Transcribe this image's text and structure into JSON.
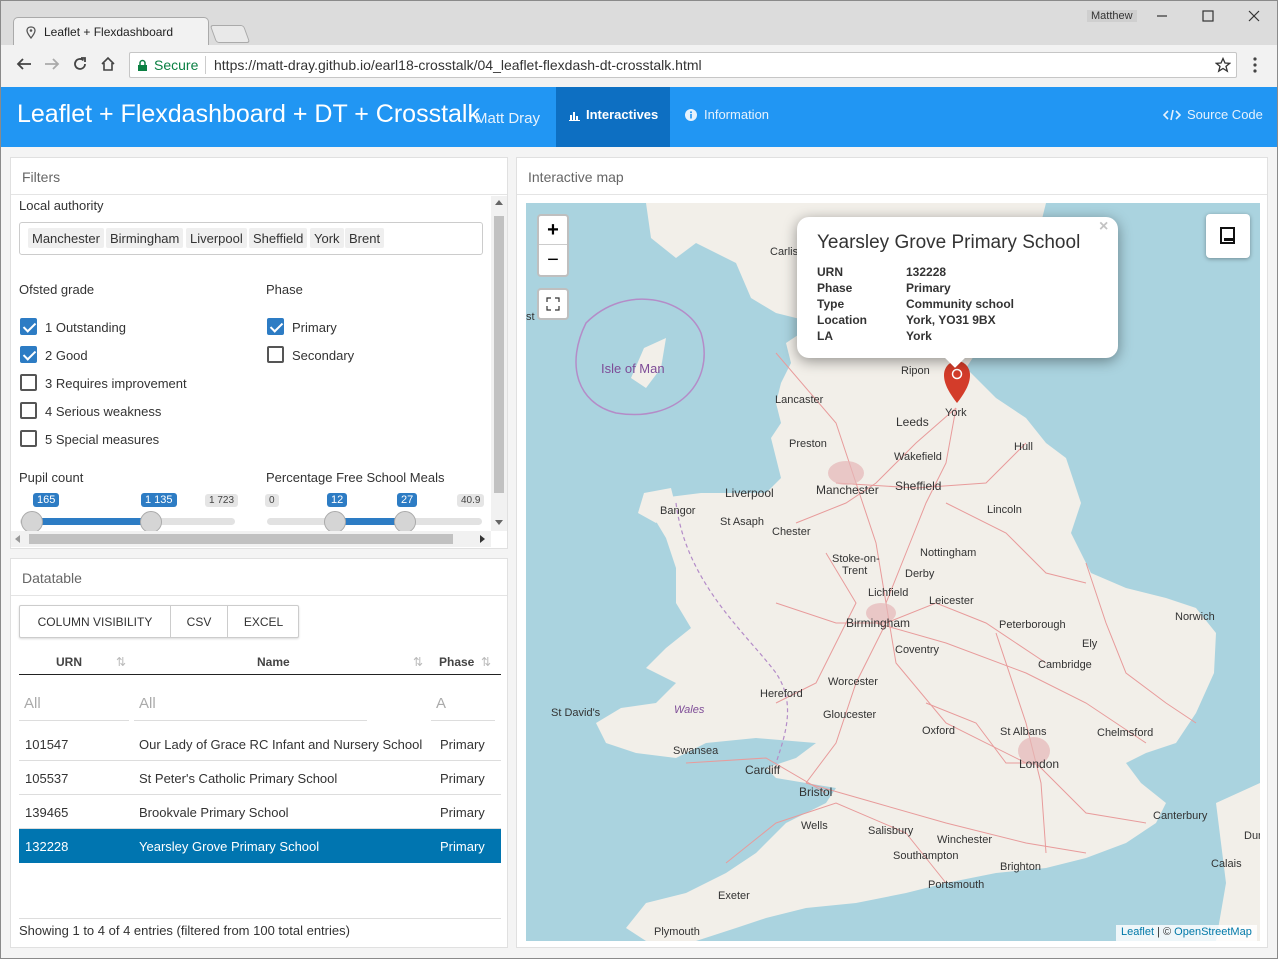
{
  "browser": {
    "tab_title": "Leaflet + Flexdashboard",
    "profile": "Matthew",
    "secure_label": "Secure",
    "url": "https://matt-dray.github.io/earl18-crosstalk/04_leaflet-flexdash-dt-crosstalk.html"
  },
  "navbar": {
    "title": "Leaflet + Flexdashboard + DT + Crosstalk",
    "author": "Matt Dray",
    "tab_interactives": "Interactives",
    "tab_information": "Information",
    "source_code": "Source Code",
    "color": "#2196f3"
  },
  "filters": {
    "title": "Filters",
    "local_authority_label": "Local authority",
    "local_authorities": [
      "Manchester",
      "Birmingham",
      "Liverpool",
      "Sheffield",
      "York",
      "Brent"
    ],
    "ofsted_label": "Ofsted grade",
    "ofsted": [
      {
        "label": "1 Outstanding",
        "checked": true
      },
      {
        "label": "2 Good",
        "checked": true
      },
      {
        "label": "3 Requires improvement",
        "checked": false
      },
      {
        "label": "4 Serious weakness",
        "checked": false
      },
      {
        "label": "5 Special measures",
        "checked": false
      }
    ],
    "phase_label": "Phase",
    "phases": [
      {
        "label": "Primary",
        "checked": true
      },
      {
        "label": "Secondary",
        "checked": false
      }
    ],
    "pupil_label": "Pupil count",
    "pupil": {
      "min_label": "165",
      "sel_max_label": "1 135",
      "max_label": "1 723",
      "min": 165,
      "max": 1723,
      "from": 165,
      "to": 1135
    },
    "fsm_label": "Percentage Free School Meals",
    "fsm": {
      "min_label": "0",
      "from_label": "12",
      "to_label": "27",
      "max_label": "40.9",
      "min": 0,
      "max": 40.9,
      "from": 12,
      "to": 27
    }
  },
  "datatable": {
    "title": "Datatable",
    "buttons": [
      "COLUMN VISIBILITY",
      "CSV",
      "EXCEL"
    ],
    "headers": [
      "URN",
      "Name",
      "Phase"
    ],
    "filter_placeholder": "All",
    "phase_filter_placeholder": "A",
    "rows": [
      {
        "urn": "101547",
        "name": "Our Lady of Grace RC Infant and Nursery School",
        "phase": "Primary",
        "selected": false
      },
      {
        "urn": "105537",
        "name": "St Peter's Catholic Primary School",
        "phase": "Primary",
        "selected": false
      },
      {
        "urn": "139465",
        "name": "Brookvale Primary School",
        "phase": "Primary",
        "selected": false
      },
      {
        "urn": "132228",
        "name": "Yearsley Grove Primary School",
        "phase": "Primary",
        "selected": true
      }
    ],
    "info": "Showing 1 to 4 of 4 entries (filtered from 100 total entries)"
  },
  "map": {
    "title": "Interactive map",
    "zoom_in": "+",
    "zoom_out": "−",
    "popup": {
      "title": "Yearsley Grove Primary School",
      "close": "×",
      "fields": [
        {
          "key": "URN",
          "value": "132228"
        },
        {
          "key": "Phase",
          "value": "Primary"
        },
        {
          "key": "Type",
          "value": "Community school"
        },
        {
          "key": "Location",
          "value": "York, YO31 9BX"
        },
        {
          "key": "LA",
          "value": "York"
        }
      ]
    },
    "places": {
      "carlisle": "Carlisle",
      "isle_of_man": "Isle of Man",
      "ripon": "Ripon",
      "york": "York",
      "lancaster": "Lancaster",
      "leeds": "Leeds",
      "preston": "Preston",
      "wakefield": "Wakefield",
      "hull": "Hull",
      "liverpool": "Liverpool",
      "manchester": "Manchester",
      "sheffield": "Sheffield",
      "bangor": "Bangor",
      "st_asaph": "St Asaph",
      "chester": "Chester",
      "lincoln": "Lincoln",
      "nottingham": "Nottingham",
      "stoke": "Stoke-on-",
      "trent": "Trent",
      "derby": "Derby",
      "lichfield": "Lichfield",
      "leicester": "Leicester",
      "norwich": "Norwich",
      "birmingham": "Birmingham",
      "peterborough": "Peterborough",
      "ely": "Ely",
      "coventry": "Coventry",
      "cambridge": "Cambridge",
      "worcester": "Worcester",
      "hereford": "Hereford",
      "st_davids": "St David's",
      "wales": "Wales",
      "gloucester": "Gloucester",
      "oxford": "Oxford",
      "st_albans": "St Albans",
      "chelmsford": "Chelmsford",
      "swansea": "Swansea",
      "cardiff": "Cardiff",
      "london": "London",
      "bristol": "Bristol",
      "canterbury": "Canterbury",
      "wells": "Wells",
      "salisbury": "Salisbury",
      "winchester": "Winchester",
      "southampton": "Southampton",
      "brighton": "Brighton",
      "portsmouth": "Portsmouth",
      "exeter": "Exeter",
      "plymouth": "Plymouth",
      "calais": "Calais",
      "dun": "Dun",
      "st_edge": "st"
    },
    "attribution_leaflet": "Leaflet",
    "attribution_sep": " | © ",
    "attribution_osm": "OpenStreetMap"
  }
}
